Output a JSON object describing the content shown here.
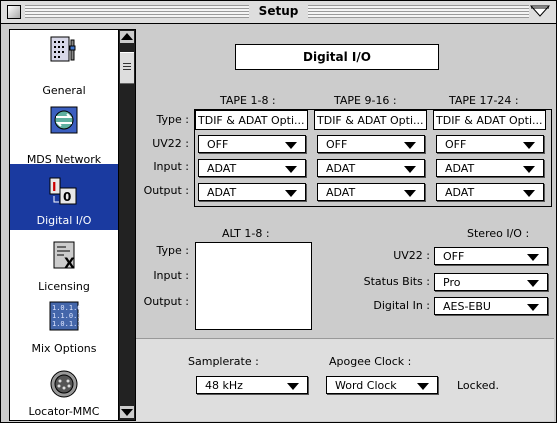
{
  "window": {
    "title": "Setup"
  },
  "sidebar": {
    "items": [
      {
        "label": "General",
        "icon": "general-settings-icon",
        "selected": false
      },
      {
        "label": "MDS Network",
        "icon": "network-icon",
        "selected": false
      },
      {
        "label": "Digital I/O",
        "icon": "digital-io-icon",
        "selected": true
      },
      {
        "label": "Licensing",
        "icon": "licensing-icon",
        "selected": false
      },
      {
        "label": "Mix Options",
        "icon": "mix-options-icon",
        "selected": false
      },
      {
        "label": "Locator-MMC",
        "icon": "locator-mmc-icon",
        "selected": false
      }
    ]
  },
  "panel": {
    "title": "Digital I/O",
    "tape_headers": [
      "TAPE 1-8 :",
      "TAPE 9-16 :",
      "TAPE 17-24 :"
    ],
    "row_labels": {
      "type": "Type :",
      "uv22": "UV22 :",
      "input": "Input :",
      "output": "Output :"
    },
    "tapes": [
      {
        "type": "TDIF & ADAT Opti...",
        "uv22": "OFF",
        "input": "ADAT",
        "output": "ADAT"
      },
      {
        "type": "TDIF & ADAT Opti...",
        "uv22": "OFF",
        "input": "ADAT",
        "output": "ADAT"
      },
      {
        "type": "TDIF & ADAT Opti...",
        "uv22": "OFF",
        "input": "ADAT",
        "output": "ADAT"
      }
    ],
    "alt": {
      "header": "ALT 1-8 :",
      "labels": {
        "type": "Type :",
        "input": "Input :",
        "output": "Output :"
      }
    },
    "stereo": {
      "header": "Stereo I/O :",
      "uv22_label": "UV22 :",
      "uv22_value": "OFF",
      "status_bits_label": "Status Bits :",
      "status_bits_value": "Pro",
      "digital_in_label": "Digital In :",
      "digital_in_value": "AES-EBU"
    }
  },
  "footer": {
    "samplerate_label": "Samplerate :",
    "samplerate_value": "48 kHz",
    "clock_label": "Apogee Clock :",
    "clock_value": "Word Clock",
    "clock_status": "Locked."
  }
}
